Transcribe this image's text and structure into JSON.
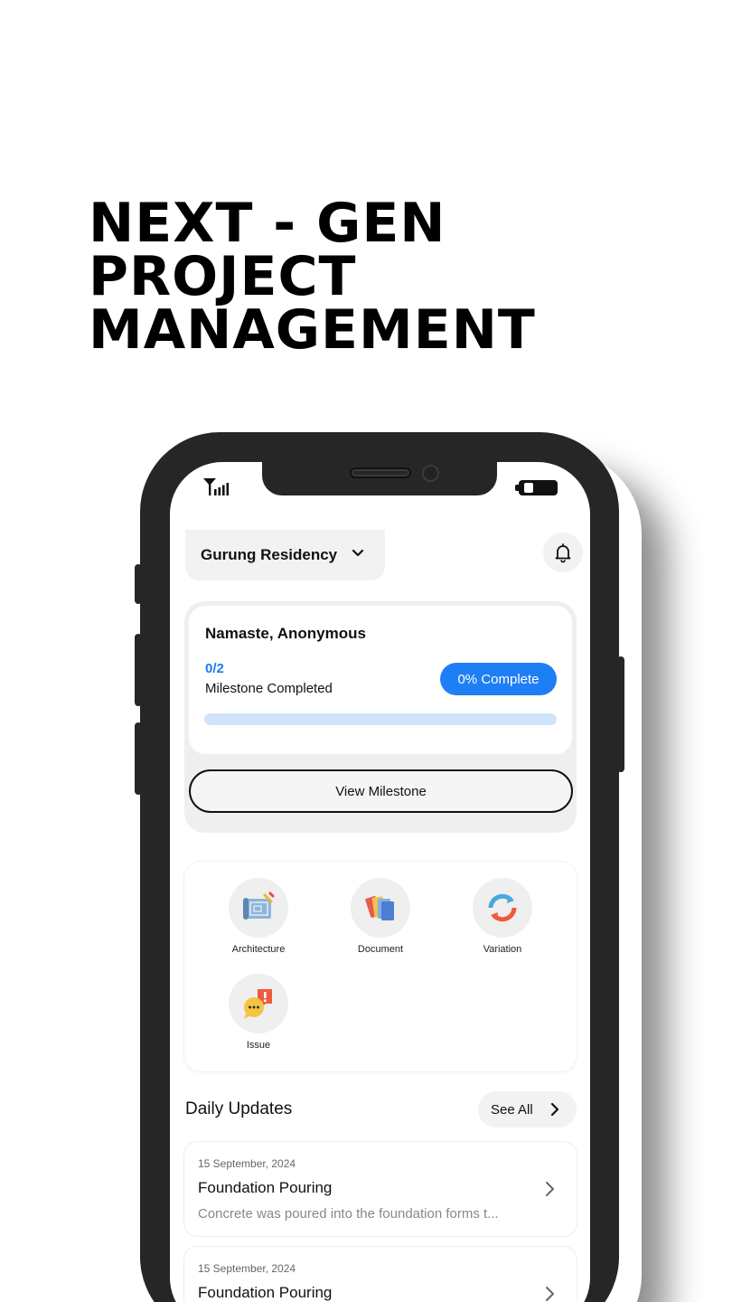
{
  "headline": {
    "lines": [
      "NEXT - GEN",
      "PROJECT",
      "MANAGEMENT"
    ]
  },
  "status_bar": {
    "signal_icon": "signal-icon",
    "battery_icon": "battery-icon"
  },
  "header": {
    "project_name": "Gurung Residency",
    "dropdown_icon": "chevron-down-icon",
    "notification_icon": "bell-icon"
  },
  "milestone_card": {
    "greeting": "Namaste, Anonymous",
    "count": "0/2",
    "label": "Milestone Completed",
    "percent_label": "0% Complete",
    "progress": 0,
    "button_label": "View Milestone"
  },
  "menu": {
    "items": [
      {
        "label": "Architecture",
        "icon": "blueprint-icon"
      },
      {
        "label": "Document",
        "icon": "folders-icon"
      },
      {
        "label": "Variation",
        "icon": "refresh-icon"
      },
      {
        "label": "Issue",
        "icon": "chat-alert-icon"
      }
    ]
  },
  "daily_updates": {
    "title": "Daily Updates",
    "see_all": "See All",
    "items": [
      {
        "date": "15 September, 2024",
        "title": "Foundation Pouring",
        "description": "Concrete was poured into the foundation forms t..."
      },
      {
        "date": "15 September, 2024",
        "title": "Foundation Pouring",
        "description": ""
      }
    ]
  },
  "colors": {
    "accent": "#1e7ef5",
    "progress_track": "#cfe3fb",
    "frame": "#262626"
  }
}
